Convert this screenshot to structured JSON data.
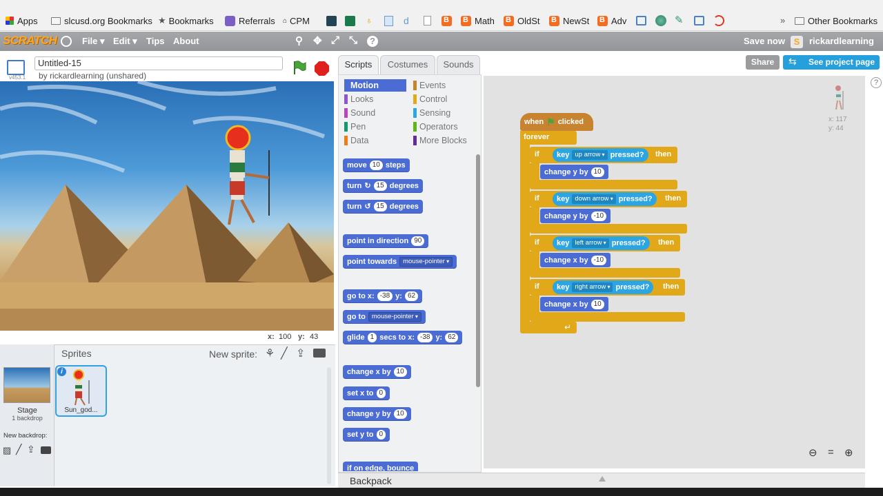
{
  "bookmarks": [
    "Apps",
    "slcusd.org Bookmarks",
    "Bookmarks",
    "Referrals",
    "CPM",
    "Math",
    "OldSt",
    "NewSt",
    "Adv",
    "Other Bookmarks"
  ],
  "menu": {
    "logo": "SCRATCH",
    "file": "File ▾",
    "edit": "Edit ▾",
    "tips": "Tips",
    "about": "About",
    "save": "Save now",
    "user": "rickardlearning"
  },
  "project": {
    "version": "v453.1",
    "title": "Untitled-15",
    "byline": "by rickardlearning (unshared)",
    "share": "Share",
    "see_page": "See project page"
  },
  "stage": {
    "mouse_x_label": "x:",
    "mouse_x": "100",
    "mouse_y_label": "y:",
    "mouse_y": "43"
  },
  "sprites": {
    "header": "Sprites",
    "new_sprite": "New sprite:",
    "stage_label": "Stage",
    "backdrop_count": "1 backdrop",
    "new_backdrop": "New backdrop:",
    "sprite_name": "Sun_god..."
  },
  "tabs": [
    "Scripts",
    "Costumes",
    "Sounds"
  ],
  "categories": {
    "left": [
      "Motion",
      "Looks",
      "Sound",
      "Pen",
      "Data"
    ],
    "right": [
      "Events",
      "Control",
      "Sensing",
      "Operators",
      "More Blocks"
    ]
  },
  "category_colors": {
    "Motion": "#4a6cd4",
    "Looks": "#8a55d7",
    "Sound": "#bb42c3",
    "Pen": "#0e9a6c",
    "Data": "#ee7d16",
    "Events": "#c88330",
    "Control": "#e1a91a",
    "Sensing": "#2ca5e2",
    "Operators": "#5cb712",
    "More Blocks": "#632d99"
  },
  "palette_blocks": {
    "move": {
      "a": "move",
      "n": "10",
      "b": "steps"
    },
    "turn_cw": {
      "a": "turn",
      "n": "15",
      "b": "degrees"
    },
    "turn_ccw": {
      "a": "turn",
      "n": "15",
      "b": "degrees"
    },
    "point_dir": {
      "a": "point in direction",
      "n": "90"
    },
    "point_towards": {
      "a": "point towards",
      "d": "mouse-pointer"
    },
    "goto_xy": {
      "a": "go to x:",
      "x": "-38",
      "b": "y:",
      "y": "62"
    },
    "goto": {
      "a": "go to",
      "d": "mouse-pointer"
    },
    "glide": {
      "a": "glide",
      "n": "1",
      "b": "secs to x:",
      "x": "-38",
      "c": "y:",
      "y": "62"
    },
    "change_x": {
      "a": "change x by",
      "n": "10"
    },
    "set_x": {
      "a": "set x to",
      "n": "0"
    },
    "change_y": {
      "a": "change y by",
      "n": "10"
    },
    "set_y": {
      "a": "set y to",
      "n": "0"
    },
    "bounce": "if on edge, bounce"
  },
  "script": {
    "hat_a": "when",
    "hat_b": "clicked",
    "forever": "forever",
    "ifs": [
      {
        "key": "up arrow",
        "change": "change y by",
        "val": "10"
      },
      {
        "key": "down arrow",
        "change": "change y by",
        "val": "-10"
      },
      {
        "key": "left arrow",
        "change": "change x by",
        "val": "-10"
      },
      {
        "key": "right arrow",
        "change": "change x by",
        "val": "10"
      }
    ],
    "if": "if",
    "key": "key",
    "pressed": "pressed?",
    "then": "then"
  },
  "sprite_info": {
    "x": "x: 117",
    "y": "y: 44"
  },
  "backpack": "Backpack"
}
